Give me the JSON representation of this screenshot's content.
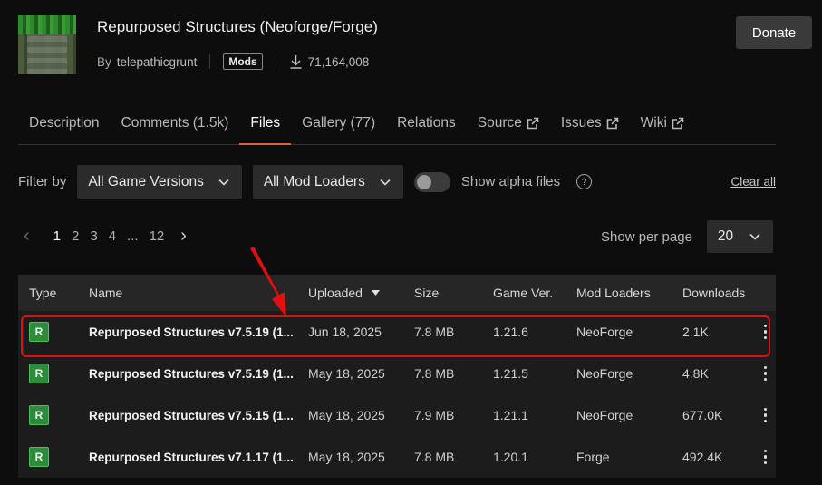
{
  "project": {
    "title": "Repurposed Structures (Neoforge/Forge)",
    "by_label": "By",
    "author": "telepathicgrunt",
    "category_badge": "Mods",
    "downloads": "71,164,008",
    "donate_label": "Donate"
  },
  "tabs": [
    {
      "label": "Description"
    },
    {
      "label": "Comments (1.5k)"
    },
    {
      "label": "Files"
    },
    {
      "label": "Gallery (77)"
    },
    {
      "label": "Relations"
    },
    {
      "label": "Source"
    },
    {
      "label": "Issues"
    },
    {
      "label": "Wiki"
    }
  ],
  "filters": {
    "label": "Filter by",
    "game_versions": "All Game Versions",
    "mod_loaders": "All Mod Loaders",
    "alpha_label": "Show alpha files",
    "help_glyph": "?",
    "clear_all": "Clear all"
  },
  "pagination": {
    "prev": "‹",
    "pages": [
      "1",
      "2",
      "3",
      "4",
      "...",
      "12"
    ],
    "next": "›",
    "per_page_label": "Show per page",
    "per_page_value": "20"
  },
  "table": {
    "headers": {
      "type": "Type",
      "name": "Name",
      "uploaded": "Uploaded",
      "size": "Size",
      "game_ver": "Game Ver.",
      "mod_loaders": "Mod Loaders",
      "downloads": "Downloads"
    },
    "rows": [
      {
        "type": "R",
        "name": "Repurposed Structures v7.5.19 (1...",
        "uploaded": "Jun 18, 2025",
        "size": "7.8 MB",
        "game_ver": "1.21.6",
        "loader": "NeoForge",
        "downloads": "2.1K"
      },
      {
        "type": "R",
        "name": "Repurposed Structures v7.5.19 (1...",
        "uploaded": "May 18, 2025",
        "size": "7.8 MB",
        "game_ver": "1.21.5",
        "loader": "NeoForge",
        "downloads": "4.8K"
      },
      {
        "type": "R",
        "name": "Repurposed Structures v7.5.15 (1...",
        "uploaded": "May 18, 2025",
        "size": "7.9 MB",
        "game_ver": "1.21.1",
        "loader": "NeoForge",
        "downloads": "677.0K"
      },
      {
        "type": "R",
        "name": "Repurposed Structures v7.1.17 (1...",
        "uploaded": "May 18, 2025",
        "size": "7.8 MB",
        "game_ver": "1.20.1",
        "loader": "Forge",
        "downloads": "492.4K"
      }
    ]
  },
  "colors": {
    "accent_tab": "#e0603a",
    "release_badge": "#2e8b3c",
    "annotation_red": "#e01010"
  },
  "icons": [
    "download-icon",
    "external-link-icon",
    "chevron-down-icon",
    "sort-desc-icon",
    "more-vertical-icon",
    "help-icon",
    "annotation-arrow"
  ]
}
